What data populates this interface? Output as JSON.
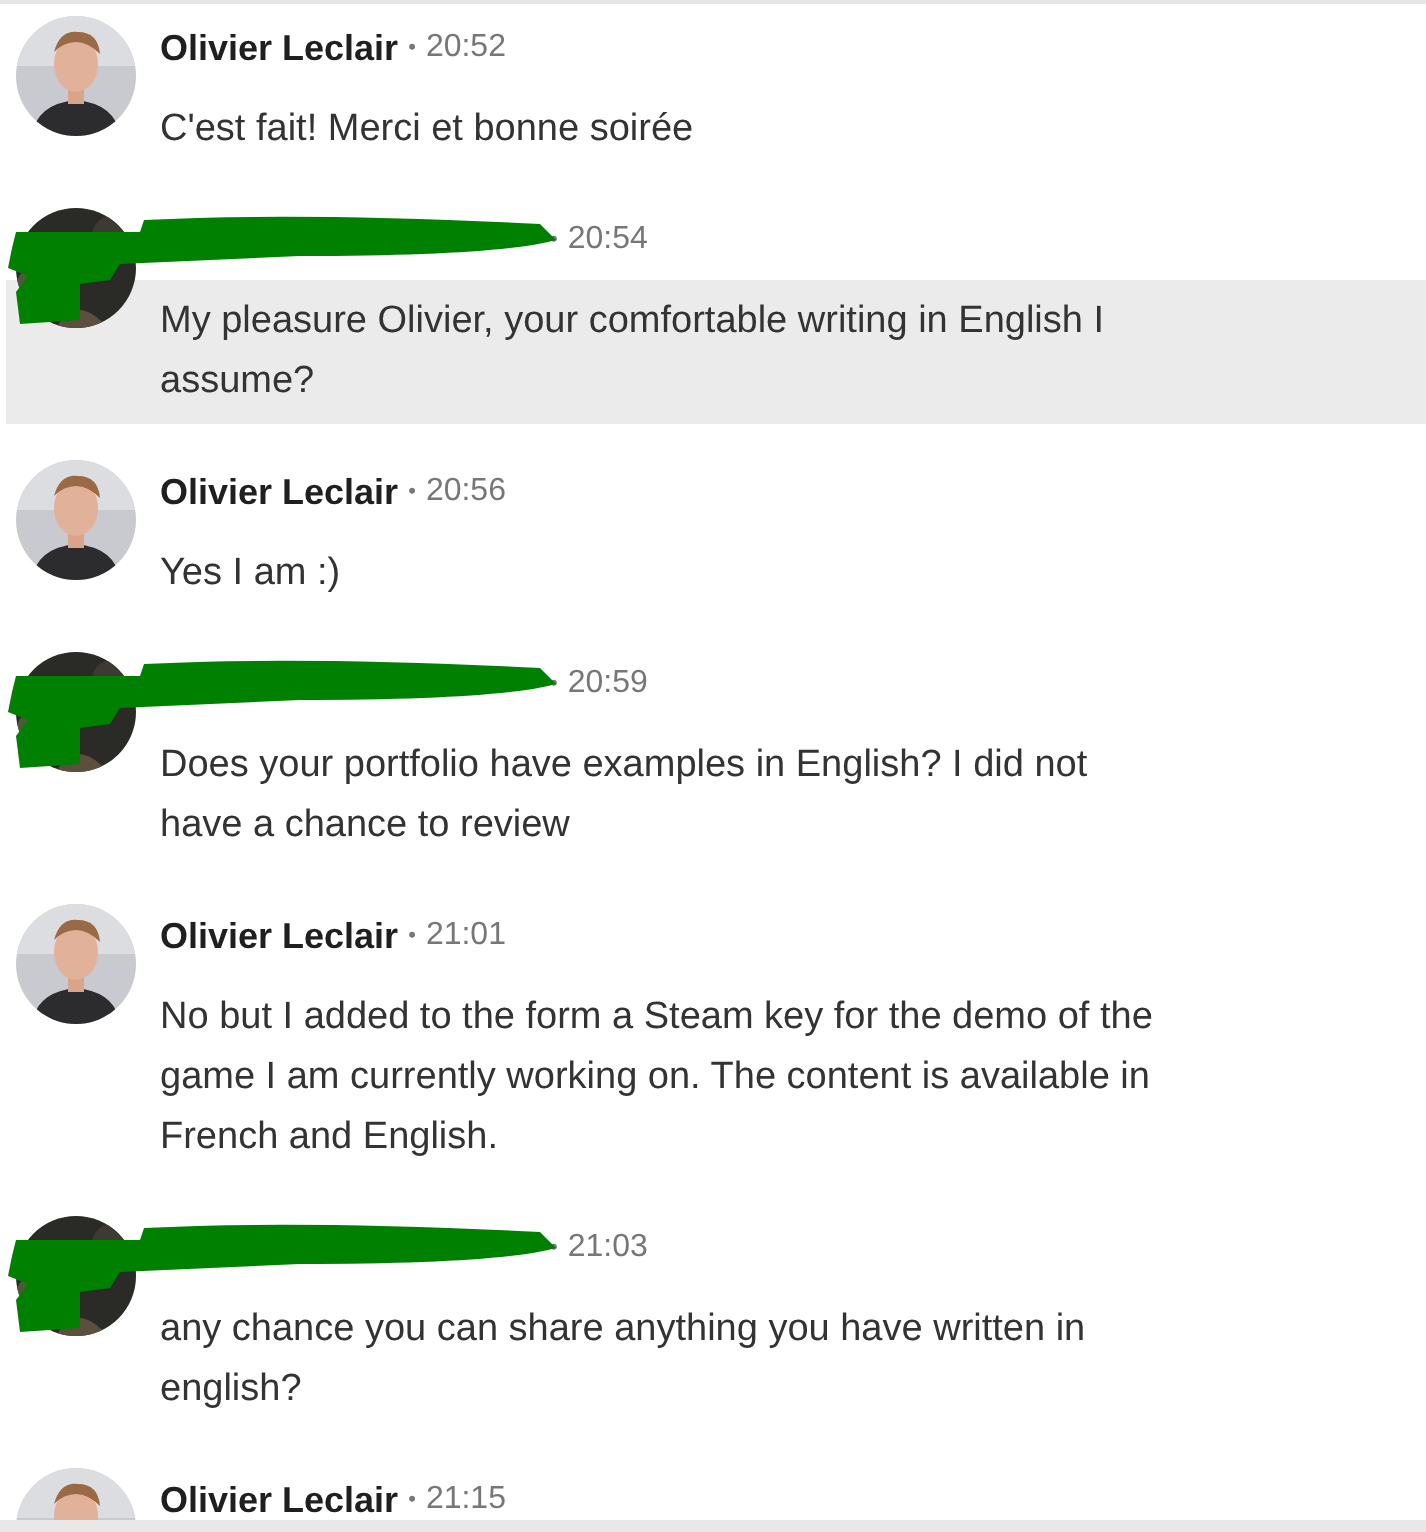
{
  "messages": [
    {
      "kind": "named",
      "author": "Olivier Leclair",
      "dot": "•",
      "time": "20:52",
      "text": "C'est fait! Merci et bonne soirée",
      "highlighted": false
    },
    {
      "kind": "redacted",
      "dot": "•",
      "time": "20:54",
      "text": "My pleasure Olivier, your comfortable writing in English I assume?",
      "highlighted": true
    },
    {
      "kind": "named",
      "author": "Olivier Leclair",
      "dot": "•",
      "time": "20:56",
      "text": "Yes I am :)",
      "highlighted": false
    },
    {
      "kind": "redacted",
      "dot": "•",
      "time": "20:59",
      "text": "Does your portfolio have examples in English? I did not have a chance to review",
      "highlighted": false
    },
    {
      "kind": "named",
      "author": "Olivier Leclair",
      "dot": "•",
      "time": "21:01",
      "text": "No but I added to the form a Steam key for the demo of the game I am currently working on. The content is available in French and English.",
      "highlighted": false
    },
    {
      "kind": "redacted",
      "dot": "•",
      "time": "21:03",
      "text": "any chance you can share anything you have written in english?",
      "highlighted": false
    },
    {
      "kind": "named",
      "author": "Olivier Leclair",
      "dot": "•",
      "time": "21:15",
      "highlighted": false
    }
  ]
}
